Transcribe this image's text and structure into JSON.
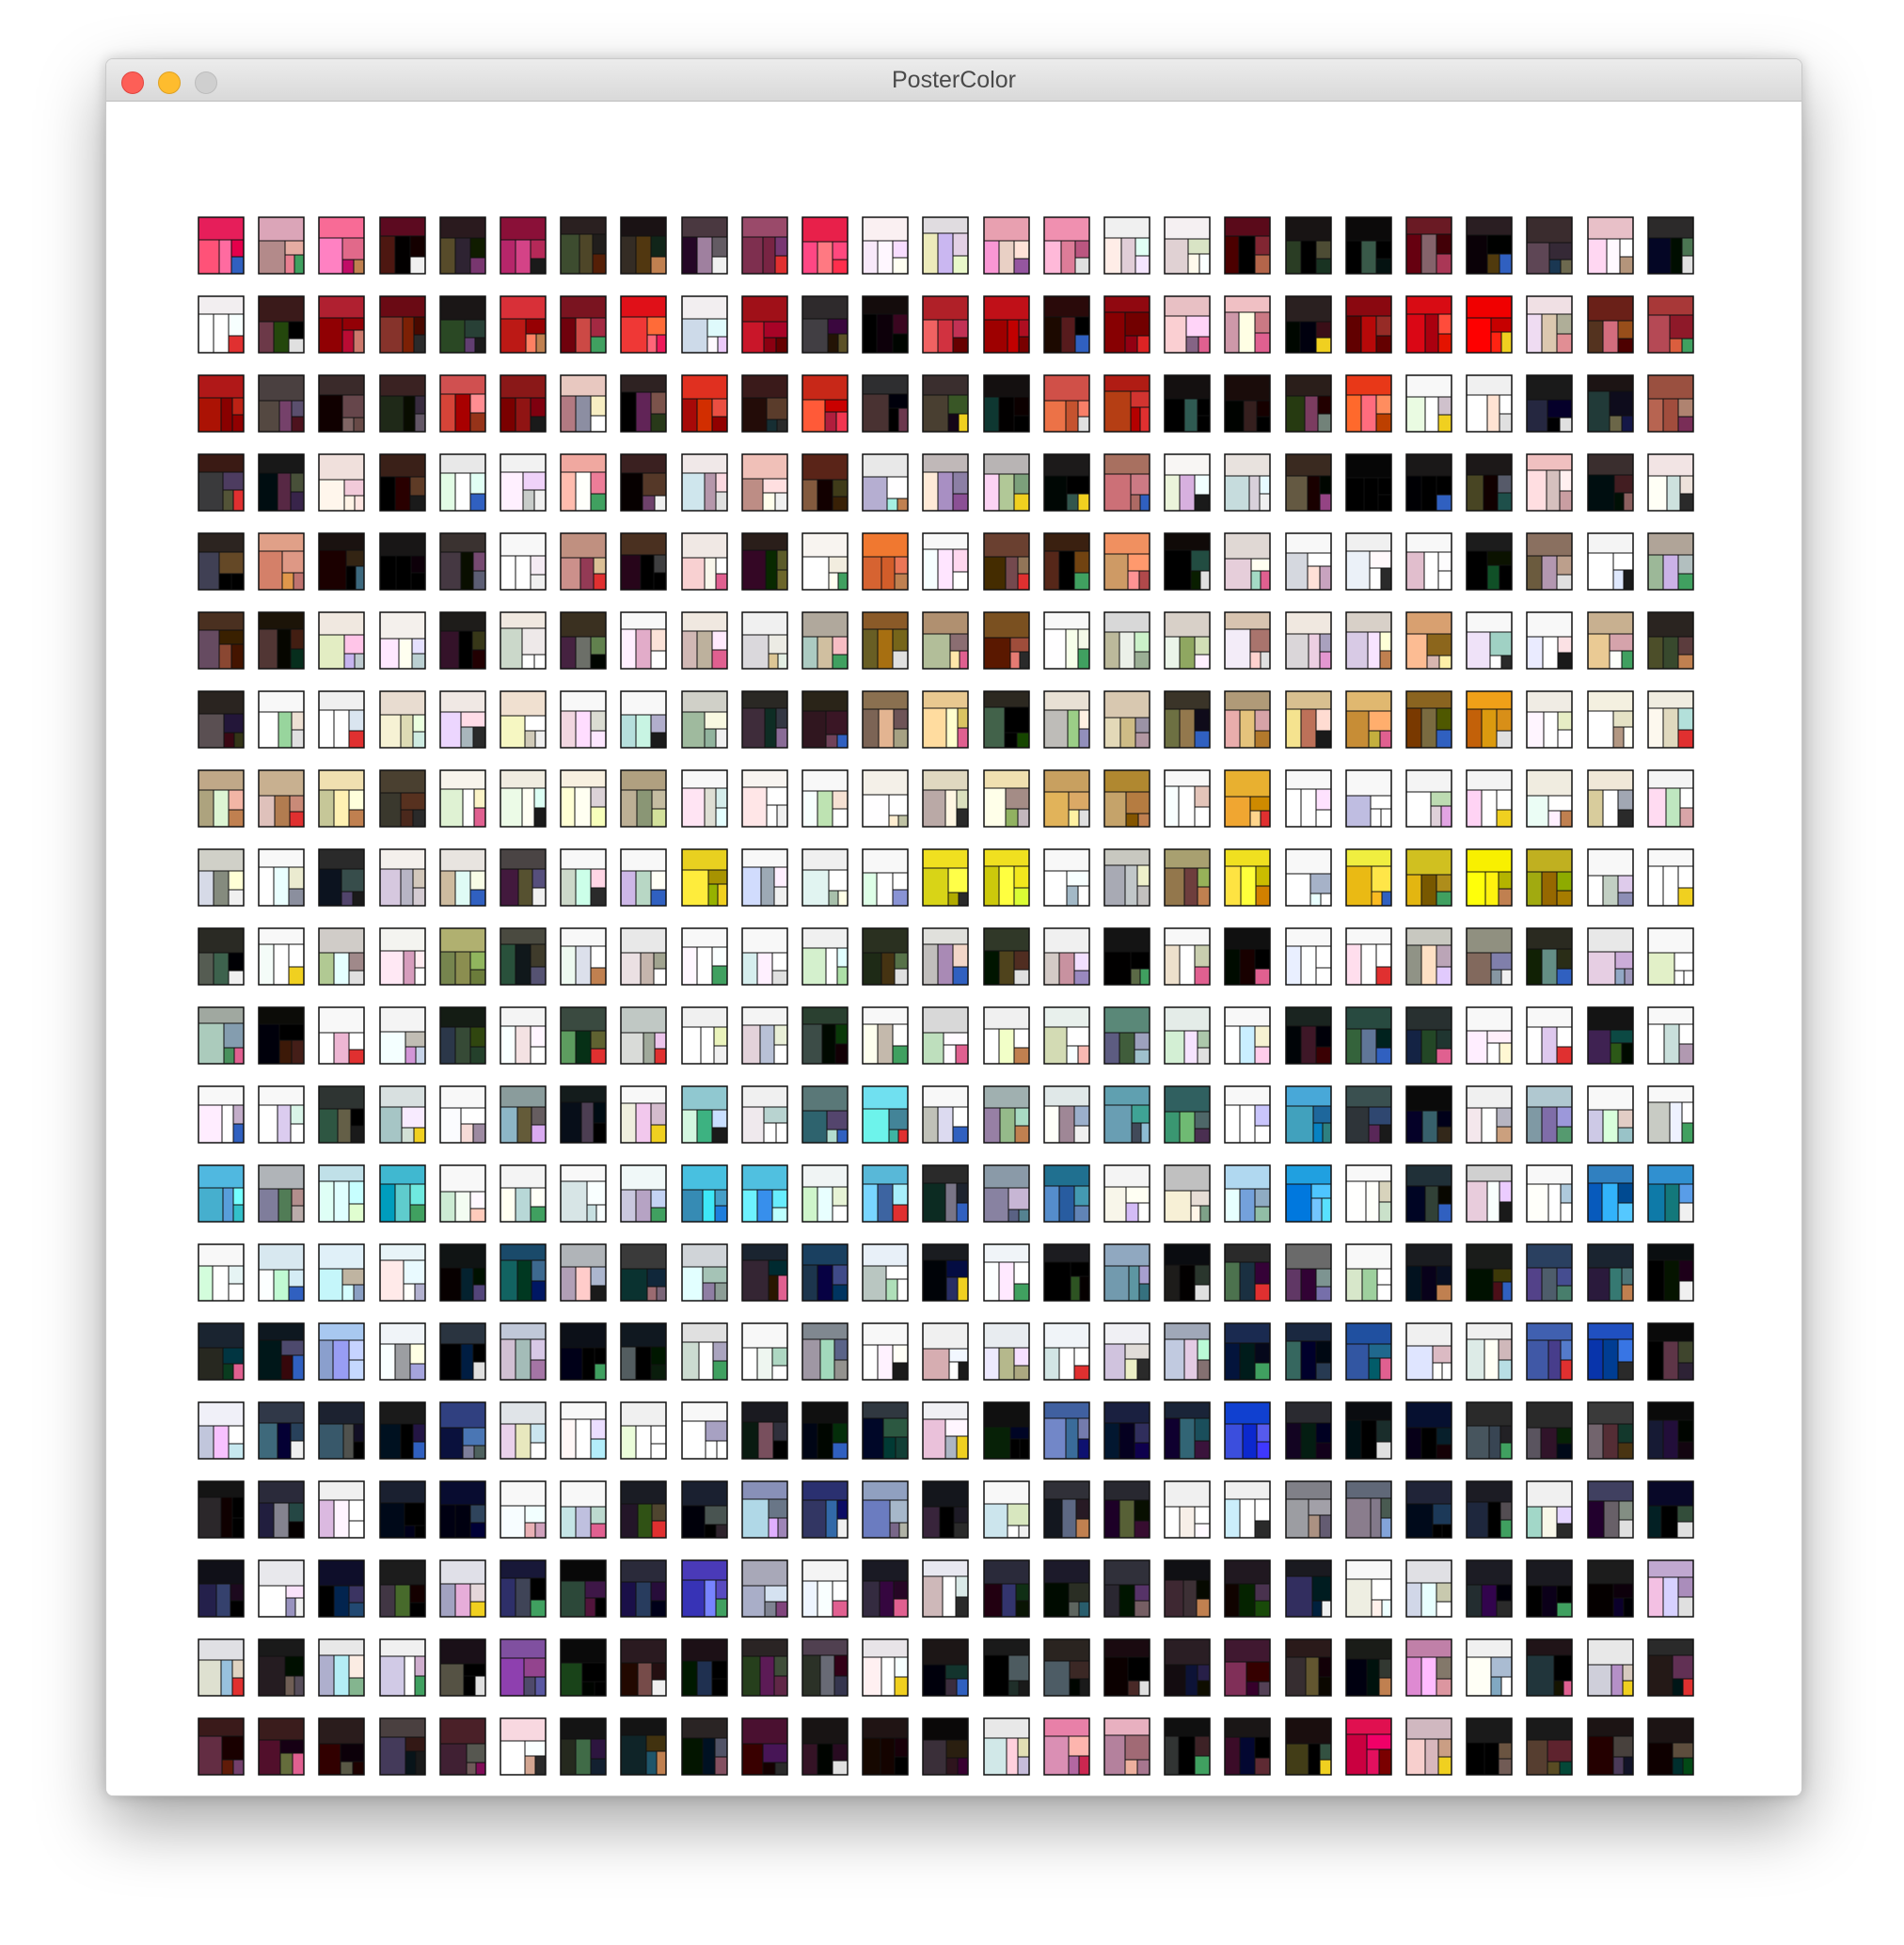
{
  "window": {
    "title": "PosterColor",
    "traffic_lights": [
      "close",
      "minimize",
      "zoom"
    ]
  },
  "grid": {
    "rows": 20,
    "columns": 25,
    "item_count": 500,
    "rows_hint_colors": [
      [
        "#e61e5a",
        "#dba5b8",
        "#f86b96",
        "#5c0a20",
        "#2a1a1e",
        "#8a1038",
        "#2a2020",
        "#1a1214",
        "#4a3840",
        "#9a4a6a",
        "#e8204a",
        "#faf0f2",
        "#e0dce0",
        "#e8a0b0",
        "#f090b0",
        "#f0f0f0",
        "#f5f0f2",
        "#5a0a1a",
        "#181414",
        "#0c0a0a",
        "#6a1a24",
        "#2a1e22",
        "#3a2c2e",
        "#e8c0c8",
        "#2c2a2a"
      ],
      [
        "#f2eef0",
        "#3a1a1a",
        "#b02030",
        "#6a0a14",
        "#1a1616",
        "#d83038",
        "#7a1420",
        "#e01018",
        "#f2eef0",
        "#a01018",
        "#2e2a2c",
        "#140c0c",
        "#b02028",
        "#c01018",
        "#2a0a0a",
        "#900810",
        "#e8c0c4",
        "#f0c0c4",
        "#2a2020",
        "#8a0810",
        "#d80c14",
        "#f00000",
        "#f0e0e4",
        "#6a2018",
        "#a83838"
      ],
      [
        "#b01818",
        "#4a4040",
        "#3a2a2a",
        "#3a2222",
        "#d05050",
        "#8a1818",
        "#e8c8c0",
        "#2e2222",
        "#e03020",
        "#3a1a1a",
        "#c82818",
        "#2e2e30",
        "#3a2e2e",
        "#141010",
        "#d05048",
        "#b01c14",
        "#141010",
        "#1a0c0a",
        "#2a1e1a",
        "#e83818",
        "#f8f8f8",
        "#f0f0f0",
        "#1a1a1a",
        "#1c1414",
        "#9a5040"
      ],
      [
        "#3a1a14",
        "#181818",
        "#f0e0dc",
        "#3a2018",
        "#e8e8e8",
        "#f2f2f2",
        "#f0a8a0",
        "#3a2020",
        "#f0e8e8",
        "#f0c0b8",
        "#5a2418",
        "#e8e8e8",
        "#c0b8b8",
        "#b8b4b4",
        "#1c1a1a",
        "#a87060",
        "#f8f6f4",
        "#e8e2de",
        "#3a2a20",
        "#060606",
        "#1a1818",
        "#1c1818",
        "#f0c0c0",
        "#3a2e2e",
        "#f2e4e4"
      ],
      [
        "#2c2420",
        "#e0a088",
        "#1a1210",
        "#181616",
        "#3a3230",
        "#f8f8f8",
        "#c09080",
        "#4a3020",
        "#f0e8e4",
        "#2a1e1a",
        "#f8f4f0",
        "#f07830",
        "#f8f8f8",
        "#6a4030",
        "#3a2010",
        "#f09060",
        "#100a08",
        "#e0d8d4",
        "#f8f8f8",
        "#f0f0f0",
        "#f8f8f8",
        "#1c1c1c",
        "#8a7060",
        "#f4f4f4",
        "#b0a498"
      ],
      [
        "#4a3020",
        "#1c1408",
        "#f0e8e0",
        "#f4f0ec",
        "#1e1c1a",
        "#f0e8e0",
        "#3a3020",
        "#f8f8f8",
        "#f0e8e0",
        "#f0f0f0",
        "#b0a89c",
        "#8a5a28",
        "#b09070",
        "#7a5020",
        "#f8f8f8",
        "#d8d8d8",
        "#d8d0c8",
        "#d8c4b0",
        "#f0e8e0",
        "#d8d0c8",
        "#d8a070",
        "#f8f8f8",
        "#f8f8f8",
        "#c8b090",
        "#2a2420"
      ],
      [
        "#2a2420",
        "#f8f8f8",
        "#f0f0f0",
        "#e8dcd0",
        "#f0e8e4",
        "#f0e0d0",
        "#f8f8f8",
        "#f8f8f8",
        "#d0d0c8",
        "#2a2824",
        "#2a2418",
        "#8a7050",
        "#e8c890",
        "#2c2820",
        "#e8e0d4",
        "#d8c8b0",
        "#3a3428",
        "#b09a78",
        "#d8c090",
        "#e0b870",
        "#8a6420",
        "#f0a018",
        "#f0ece4",
        "#f4f0e0",
        "#f0ece0"
      ],
      [
        "#c0a888",
        "#c8b090",
        "#f0e0b0",
        "#4a4030",
        "#f8f4ec",
        "#f0ece0",
        "#f8f0e0",
        "#b0a080",
        "#f8f8f8",
        "#f8f4f0",
        "#f8f8f8",
        "#f4f0e8",
        "#e0d8c0",
        "#f0e0b0",
        "#c8a060",
        "#b08830",
        "#f8f8f8",
        "#e8b030",
        "#f8f8f8",
        "#f8f8f8",
        "#f4f4f4",
        "#f4f4f4",
        "#f0ece0",
        "#f0e8d8",
        "#f4f4f4"
      ],
      [
        "#d0d0c8",
        "#f8f8f8",
        "#2a2a2a",
        "#f4f0ec",
        "#e8e4e0",
        "#4a4444",
        "#f8f8f8",
        "#f8f8f8",
        "#e8d020",
        "#f8f8f8",
        "#f0f0f0",
        "#f8f8f8",
        "#f0e020",
        "#f0e020",
        "#f8f8f8",
        "#c8c8c0",
        "#a8a070",
        "#f0e020",
        "#f8f8f8",
        "#f0ee40",
        "#d0c020",
        "#f8f000",
        "#c0b020",
        "#f8f8f8",
        "#f8f8f8"
      ],
      [
        "#2a2a24",
        "#f8f8f8",
        "#d0ccc8",
        "#f4f4f0",
        "#b0b070",
        "#4a4a40",
        "#f8f8f8",
        "#e8e8e8",
        "#f8f8f8",
        "#f8f8f8",
        "#f0f0f0",
        "#2a3020",
        "#e0e0dc",
        "#303828",
        "#f0f0f0",
        "#141414",
        "#f8f8f8",
        "#101010",
        "#f8f8f8",
        "#f8f8f8",
        "#c8c8c0",
        "#909080",
        "#2a2a20",
        "#e8e8e8",
        "#f8f8f8"
      ],
      [
        "#a0a8a0",
        "#0c0c08",
        "#f8f8f8",
        "#f4f4f4",
        "#141c14",
        "#f4f4f4",
        "#3a4a40",
        "#c0c8c4",
        "#f0f0f0",
        "#f4f4f4",
        "#2a4030",
        "#f8f8f8",
        "#d8d8d8",
        "#f0f0f0",
        "#e8f0ec",
        "#5a8878",
        "#e4ece8",
        "#f8f8f8",
        "#1a2420",
        "#284a40",
        "#283030",
        "#f8f8f8",
        "#f8f8f8",
        "#141414",
        "#f8f8f8"
      ],
      [
        "#f8f8f8",
        "#f8f8f8",
        "#2e3432",
        "#d8e0e0",
        "#f8f8f8",
        "#8a9c9c",
        "#141c1c",
        "#f8f8f8",
        "#90c8d0",
        "#f0f0f0",
        "#5a7878",
        "#70e0f0",
        "#f8f8f8",
        "#a0b0b0",
        "#e0e8e8",
        "#60a0b0",
        "#306060",
        "#f8f8f8",
        "#48a8d8",
        "#3a5050",
        "#0a0a0a",
        "#f0f0f0",
        "#b0c8d0",
        "#f8f8f8",
        "#f8f8f8"
      ],
      [
        "#50b8e0",
        "#b0b4b8",
        "#c0e0e8",
        "#40b8d0",
        "#f8f8f8",
        "#f4f4f4",
        "#f8f8f8",
        "#f0f8f8",
        "#48c0e0",
        "#50c0e0",
        "#f0f4f4",
        "#58b8d8",
        "#2a2a2a",
        "#8a9aa8",
        "#207090",
        "#f4f4f4",
        "#c0c0c0",
        "#b0d8f0",
        "#20a0e0",
        "#f8f8f8",
        "#203038",
        "#d0d0d0",
        "#f8f8f8",
        "#3080c0",
        "#3090d0"
      ],
      [
        "#f8f8f8",
        "#d8e8f0",
        "#e0f0f8",
        "#e8f4f8",
        "#101414",
        "#1a4a6a",
        "#b0b4b8",
        "#3a3a3a",
        "#d0d4d8",
        "#1a2430",
        "#1a4060",
        "#e8f0f8",
        "#1a1c20",
        "#f0f4f8",
        "#1c1c20",
        "#90a8c0",
        "#0a0c10",
        "#2a2a2a",
        "#6a6a6a",
        "#f8f8f8",
        "#1a1c20",
        "#1a1c1a",
        "#2a4060",
        "#1a2430",
        "#0a0e10"
      ],
      [
        "#1a2430",
        "#0e1820",
        "#a8c8f0",
        "#f0f4f8",
        "#2a3440",
        "#c0c8d8",
        "#0c1018",
        "#101820",
        "#e0e0e0",
        "#f8f8f8",
        "#808890",
        "#f8f8f8",
        "#f0f0f0",
        "#e8ecf0",
        "#f0f4f8",
        "#f0f0f4",
        "#a0a8b8",
        "#1a2a50",
        "#1a2840",
        "#2050a0",
        "#f0f0f0",
        "#f0f0f0",
        "#4060b0",
        "#2050c0",
        "#0a0a0a"
      ],
      [
        "#f0f0f8",
        "#303848",
        "#1c2230",
        "#1a1a1a",
        "#304080",
        "#e0e4e8",
        "#f8f8f8",
        "#f0f0f0",
        "#f8f8f8",
        "#1a1a20",
        "#101010",
        "#303840",
        "#f0f0f4",
        "#101010",
        "#4060a0",
        "#1a2040",
        "#1a2438",
        "#1040d0",
        "#2a2a30",
        "#0a0c10",
        "#061030",
        "#2a2a2a",
        "#2a2a2a",
        "#3a3a3a",
        "#0a0a0a"
      ],
      [
        "#141414",
        "#2a2a3a",
        "#f0f0f0",
        "#1a2030",
        "#080c30",
        "#f8f8f8",
        "#f8f8f8",
        "#1a1c24",
        "#1a2030",
        "#8890b8",
        "#2a3070",
        "#90a0c0",
        "#14161c",
        "#f8f8f8",
        "#303038",
        "#282830",
        "#f0f0f0",
        "#f0f0f0",
        "#808088",
        "#606878",
        "#202438",
        "#1c1c24",
        "#f0f0f0",
        "#404060",
        "#080828"
      ],
      [
        "#101018",
        "#e8e8ec",
        "#0e0e2a",
        "#1c1c1c",
        "#e0e0e8",
        "#181838",
        "#080808",
        "#2a2a3a",
        "#4a3ab8",
        "#a8a8b8",
        "#f4f4f4",
        "#1a1a24",
        "#e8e8f0",
        "#2a2a3a",
        "#1c1a2a",
        "#30303a",
        "#101014",
        "#201820",
        "#1a1a20",
        "#f8f8f8",
        "#e0e0e4",
        "#1c1c24",
        "#1a1a20",
        "#1c1c1c",
        "#c0a8d0"
      ],
      [
        "#e0e0e4",
        "#1a1a1a",
        "#e8e8e8",
        "#f0f0f0",
        "#1a1018",
        "#8050a0",
        "#0a0a0a",
        "#2a1a20",
        "#1c1016",
        "#2a2424",
        "#504050",
        "#e8e4e8",
        "#1c1616",
        "#1a1a1a",
        "#2a2420",
        "#1a0a10",
        "#2a1e24",
        "#401830",
        "#2a1a1a",
        "#1a1c18",
        "#c080a8",
        "#f0f0f0",
        "#201418",
        "#e8e8e8",
        "#2a2a2a"
      ],
      [
        "#3a1a1a",
        "#3a1c1c",
        "#2a1c1c",
        "#4a4040",
        "#4a2028",
        "#f8d8e0",
        "#141414",
        "#141414",
        "#2a2424",
        "#4a1030",
        "#181414",
        "#201414",
        "#0a0808",
        "#e8e8e8",
        "#e880a8",
        "#e8b0c0",
        "#101010",
        "#1a1616",
        "#1a0e0e",
        "#e01050",
        "#d0b8c0",
        "#1a1a1a",
        "#1a1a1a",
        "#1c1414",
        "#1c1414"
      ]
    ]
  }
}
